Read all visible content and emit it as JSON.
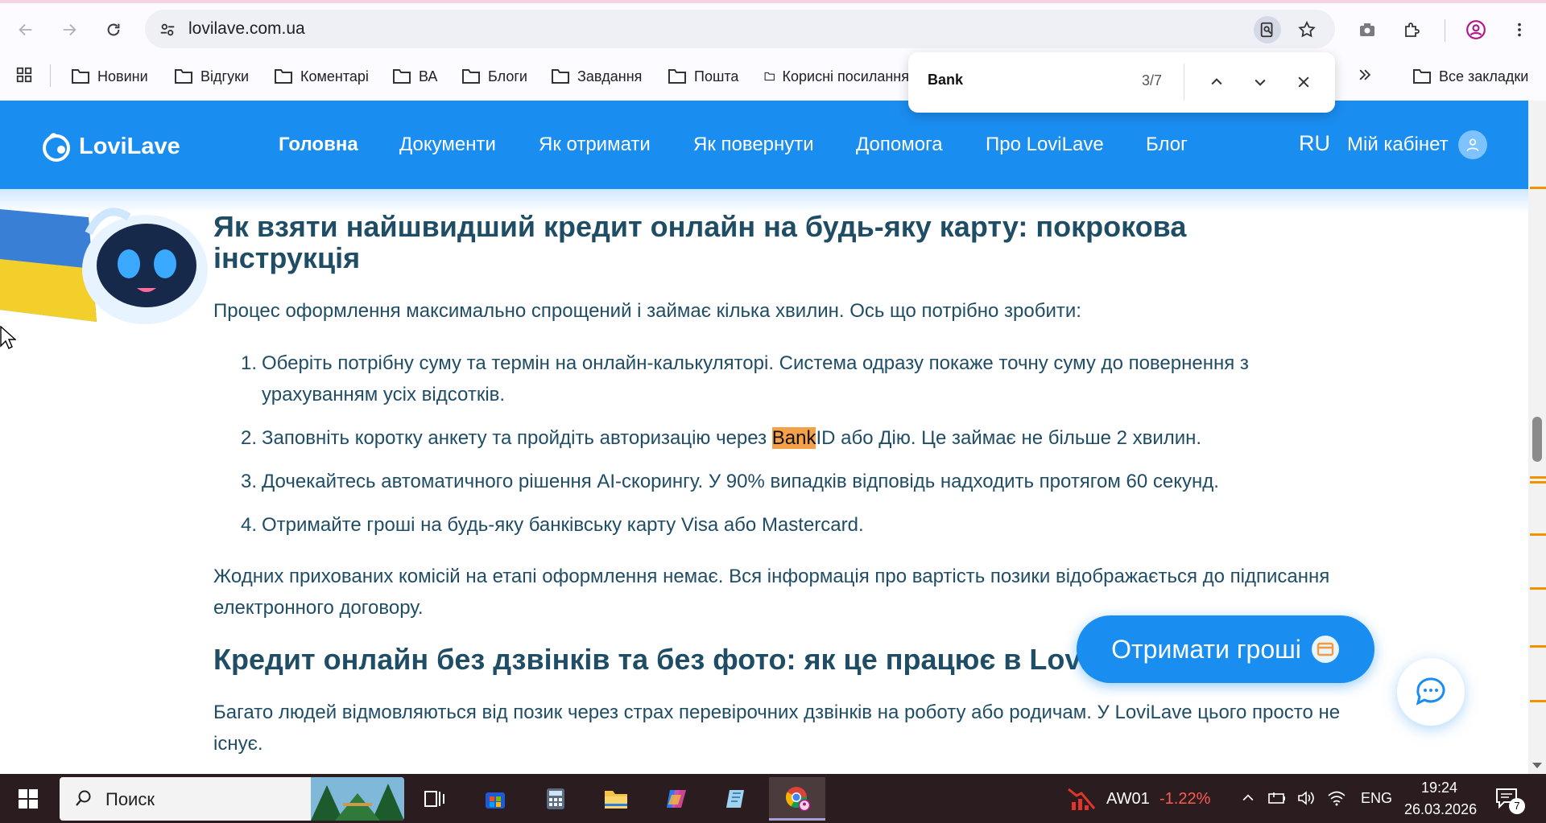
{
  "browser": {
    "url": "lovilave.com.ua",
    "bookmarks": [
      "Новини",
      "Відгуки",
      "Коментарі",
      "ВА",
      "Блоги",
      "Завдання",
      "Пошта",
      "Корисні посилання"
    ],
    "all_bookmarks_label": "Все закладки",
    "find": {
      "query": "Bank",
      "count": "3/7"
    }
  },
  "site": {
    "logo_text": "LoviLave",
    "nav": [
      "Головна",
      "Документи",
      "Як отримати",
      "Як повернути",
      "Допомога",
      "Про LoviLave",
      "Блог"
    ],
    "lang": "RU",
    "cabinet_label": "Мій кабінет",
    "accent_color": "#1a8df0"
  },
  "article": {
    "heading1": "Як взяти найшвидший кредит онлайн на будь-яку карту: покрокова інструкція",
    "intro": "Процес оформлення максимально спрощений і займає кілька хвилин. Ось що потрібно зробити:",
    "steps": [
      {
        "num": "1.",
        "text": "Оберіть потрібну суму та термін на онлайн-калькуляторі. Система одразу покаже точну суму до повернення з урахуванням усіх відсотків."
      },
      {
        "num": "2.",
        "before": "Заповніть коротку анкету та пройдіть авторизацію через ",
        "highlight": "Bank",
        "after": "ID або Дію. Це займає не більше 2 хвилин."
      },
      {
        "num": "3.",
        "text": "Дочекайтесь автоматичного рішення AI-скорингу. У 90% випадків відповідь надходить протягом 60 секунд."
      },
      {
        "num": "4.",
        "text": "Отримайте гроші на будь-яку банківську карту Visa або Mastercard."
      }
    ],
    "note": "Жодних прихованих комісій на етапі оформлення немає. Вся інформація про вартість позики відображається до підписання електронного договору.",
    "heading2": "Кредит онлайн без дзвінків та без фото: як це працює в LoviLave",
    "para2": "Багато людей відмовляються від позик через страх перевірочних дзвінків на роботу або родичам. У LoviLave цього просто не існує."
  },
  "cta_label": "Отримати гроші",
  "taskbar": {
    "search_placeholder": "Поиск",
    "ticker_name": "AW01",
    "ticker_change": "-1.22%",
    "lang": "ENG",
    "time": "19:24",
    "date": "26.03.2026",
    "notifications": "7"
  }
}
